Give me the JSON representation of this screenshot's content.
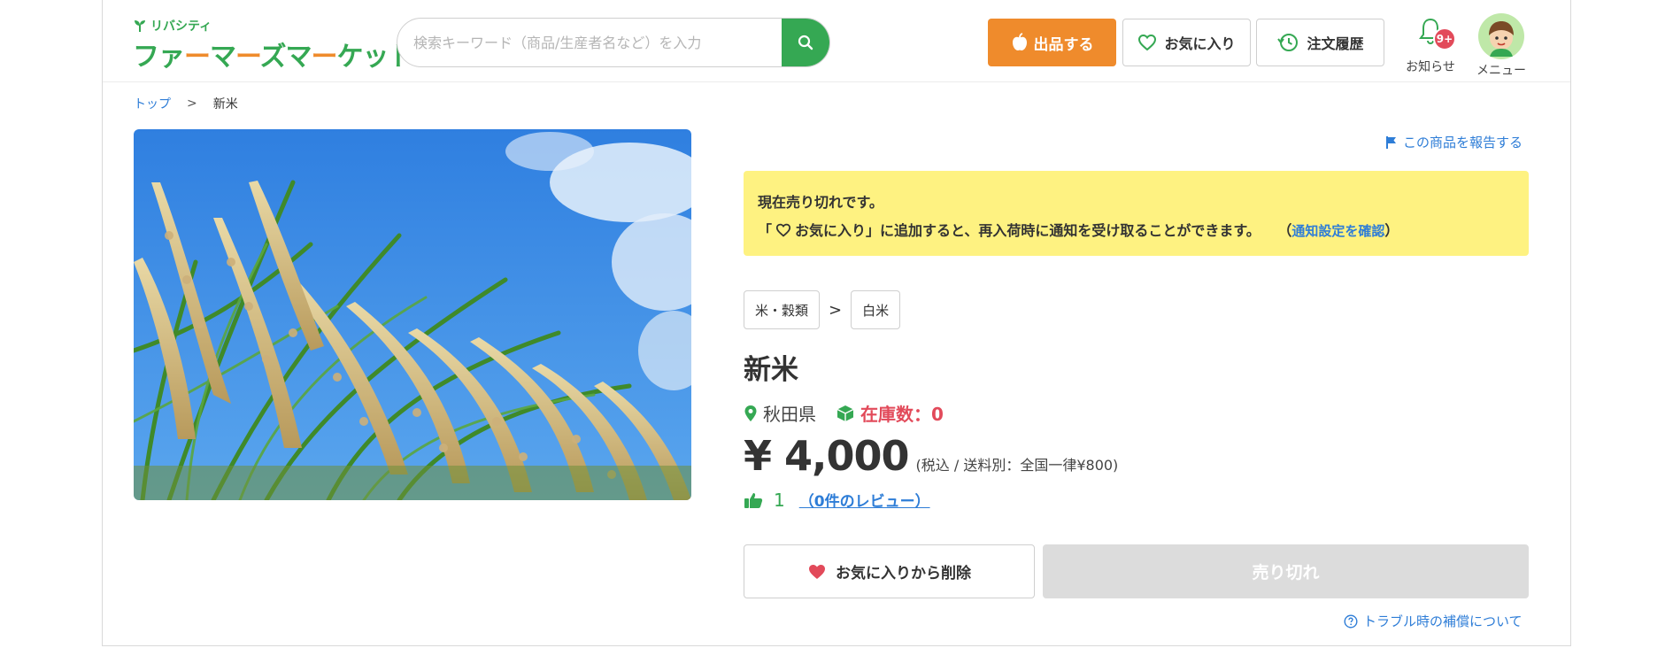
{
  "header": {
    "logo_sub": "リバシティ",
    "logo_main_parts": [
      "ファ",
      "ー",
      "マ",
      "ー",
      "ズマ",
      "ー",
      "ケット"
    ],
    "search": {
      "placeholder": "検索キーワード（商品/生産者名など）を入力",
      "value": ""
    },
    "sell_label": "出品する",
    "favorites_label": "お気に入り",
    "orders_label": "注文履歴",
    "notifications": {
      "label": "お知らせ",
      "badge": "9+"
    },
    "menu_label": "メニュー"
  },
  "breadcrumb": {
    "home": "トップ",
    "separator": ">",
    "current": "新米"
  },
  "product": {
    "report_label": "この商品を報告する",
    "soldout_notice": {
      "line1": "現在売り切れです。",
      "line2_prefix": "「",
      "line2_fav": "お気に入り",
      "line2_rest": "」に追加すると、再入荷時に通知を受け取ることができます。",
      "link_open": "（",
      "link_text": "通知設定を確認",
      "link_close": "）"
    },
    "categories": [
      "米・穀類",
      "白米"
    ],
    "category_separator": ">",
    "title": "新米",
    "prefecture": "秋田県",
    "stock": "在庫数：0",
    "price": "¥ 4,000",
    "price_note": "(税込 / 送料別：全国一律¥800)",
    "likes": "1",
    "reviews_link": "（0件のレビュー）",
    "unfavorite_label": "お気に入りから削除",
    "soldout_label": "売り切れ",
    "guarantee_label": "トラブル時の補償について"
  },
  "colors": {
    "brand_green": "#35a853",
    "accent_orange": "#ef8b2c",
    "link_blue": "#2e7dd7",
    "alert_red": "#e24a5a",
    "notice_yellow": "#fef281",
    "disabled_gray": "#dcdcdc"
  }
}
